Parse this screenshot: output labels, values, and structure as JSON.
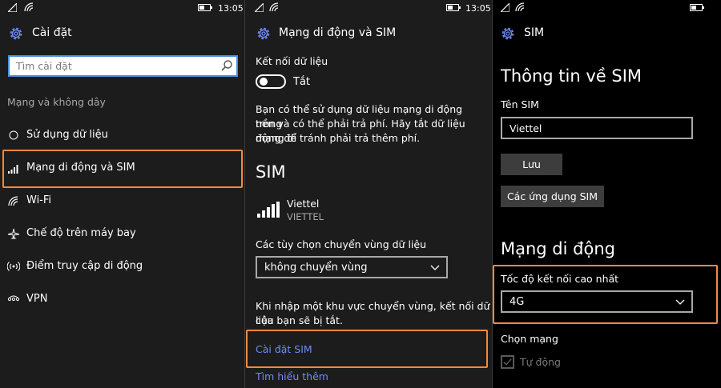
{
  "screen1": {
    "status": {
      "time": "13:05"
    },
    "header": {
      "title": "Cài đặt",
      "icon": "gear-icon"
    },
    "search": {
      "placeholder": "Tìm cài đặt"
    },
    "section_label": "Mạng và không dây",
    "items": [
      {
        "label": "Sử dụng dữ liệu",
        "icon": "data-usage-icon"
      },
      {
        "label": "Mạng di động và SIM",
        "icon": "cellular-icon"
      },
      {
        "label": "Wi-Fi",
        "icon": "wifi-icon"
      },
      {
        "label": "Chế độ trên máy bay",
        "icon": "airplane-icon"
      },
      {
        "label": "Điểm truy cập di động",
        "icon": "hotspot-icon"
      },
      {
        "label": "VPN",
        "icon": "vpn-icon"
      }
    ]
  },
  "screen2": {
    "status": {
      "time": "13:05"
    },
    "header": {
      "title": "Mạng di động và SIM",
      "icon": "gear-icon"
    },
    "data_connection": {
      "label": "Kết nối dữ liệu",
      "toggle_state": "Tắt"
    },
    "description": [
      "Bạn có thể sử dụng dữ liệu mạng di động trong",
      "nền và có thể phải trả phí. Hãy tắt dữ liệu mạng di",
      "động để tránh phải trả thêm phí."
    ],
    "sim_heading": "SIM",
    "sim": {
      "name": "Viettel",
      "operator": "VIETTEL"
    },
    "roaming": {
      "label": "Các tùy chọn chuyển vùng dữ liệu",
      "value": "không chuyển vùng"
    },
    "roaming_note": [
      "Khi nhập một khu vực chuyển vùng, kết nối dữ liệu",
      "của bạn sẽ bị tắt."
    ],
    "sim_settings_link": "Cài đặt SIM",
    "learn_more_link": "Tìm hiểu thêm"
  },
  "screen3": {
    "header": {
      "title": "SIM",
      "icon": "gear-icon"
    },
    "sim_info_heading": "Thông tin về SIM",
    "sim_name_label": "Tên SIM",
    "sim_name_value": "Viettel",
    "save_button": "Lưu",
    "sim_apps_button": "Các ứng dụng SIM",
    "mobile_network_heading": "Mạng di động",
    "max_speed_label": "Tốc độ kết nối cao nhất",
    "max_speed_value": "4G",
    "choose_network_label": "Chọn mạng",
    "auto_label": "Tự động"
  },
  "colors": {
    "highlight_border": "#ef8a43",
    "link": "#6e8cf5",
    "search_border": "#4a90e2"
  }
}
